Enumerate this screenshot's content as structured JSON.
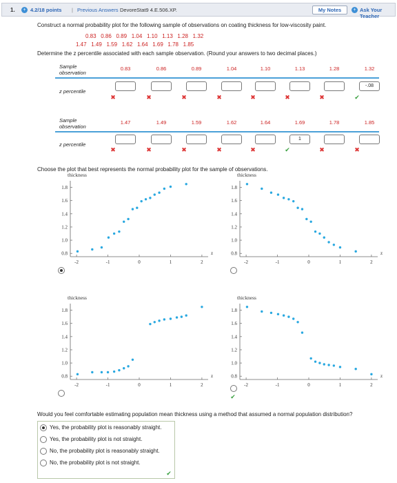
{
  "header": {
    "question_number": "1.",
    "points": "4.2/18 points",
    "separator": "|",
    "previous_answers": "Previous Answers",
    "source_ref": "DevoreStat9 4.E.506.XP.",
    "my_notes": "My Notes",
    "ask_teacher": "Ask Your Teacher"
  },
  "question": {
    "prompt": "Construct a normal probability plot for the following sample of observations on coating thickness for low-viscosity paint.",
    "data_line_1": "0.83   0.86   0.89   1.04   1.10   1.13   1.28   1.32",
    "data_line_2": "1.47   1.49   1.59   1.62   1.64   1.69   1.78   1.85",
    "instruction": "Determine the z percentile associated with each sample observation. (Round your answers to two decimal places.)"
  },
  "table": {
    "sample_label_1": "Sample",
    "sample_label_2": "observation",
    "z_label": "z percentile",
    "row1_values": [
      "0.83",
      "0.86",
      "0.89",
      "1.04",
      "1.10",
      "1.13",
      "1.28",
      "1.32"
    ],
    "row1_inputs": [
      "",
      "",
      "",
      "",
      "",
      "",
      "",
      "-.08"
    ],
    "row1_marks": [
      "x",
      "x",
      "x",
      "x",
      "x",
      "x",
      "x",
      "check"
    ],
    "row2_values": [
      "1.47",
      "1.49",
      "1.59",
      "1.62",
      "1.64",
      "1.69",
      "1.78",
      "1.85"
    ],
    "row2_inputs": [
      "",
      "",
      "",
      "",
      "",
      "1",
      "",
      ""
    ],
    "row2_marks": [
      "x",
      "x",
      "x",
      "x",
      "x",
      "check",
      "x",
      "x"
    ]
  },
  "plot_question": "Choose the plot that best represents the normal probability plot for the sample of observations.",
  "plots": {
    "y_label": "thickness",
    "x_label": "z",
    "y_ticks": [
      "1.8",
      "1.6",
      "1.4",
      "1.2",
      "1.0",
      "0.8"
    ],
    "x_ticks": [
      "-2",
      "-1",
      "0",
      "1",
      "2"
    ],
    "selected_index": 0,
    "correct_index": 3
  },
  "chart_data": [
    {
      "type": "scatter",
      "title": "",
      "xlabel": "z",
      "ylabel": "thickness",
      "xlim": [
        -2.2,
        2.2
      ],
      "ylim": [
        0.75,
        1.9
      ],
      "x": [
        -1.97,
        -1.5,
        -1.2,
        -0.98,
        -0.8,
        -0.64,
        -0.49,
        -0.35,
        -0.21,
        -0.07,
        0.07,
        0.21,
        0.35,
        0.49,
        0.64,
        0.8,
        1.0,
        1.5
      ],
      "y": [
        0.83,
        0.86,
        0.89,
        1.04,
        1.1,
        1.13,
        1.28,
        1.32,
        1.47,
        1.49,
        1.59,
        1.62,
        1.64,
        1.69,
        1.72,
        1.78,
        1.81,
        1.85
      ]
    },
    {
      "type": "scatter",
      "title": "",
      "xlabel": "z",
      "ylabel": "thickness",
      "xlim": [
        -2.2,
        2.2
      ],
      "ylim": [
        0.75,
        1.9
      ],
      "x": [
        -1.97,
        -1.5,
        -1.2,
        -0.98,
        -0.8,
        -0.64,
        -0.49,
        -0.35,
        -0.21,
        -0.07,
        0.07,
        0.21,
        0.35,
        0.49,
        0.64,
        0.8,
        1.0,
        1.5
      ],
      "y": [
        1.85,
        1.78,
        1.72,
        1.69,
        1.64,
        1.62,
        1.59,
        1.49,
        1.47,
        1.32,
        1.28,
        1.13,
        1.1,
        1.04,
        0.97,
        0.93,
        0.89,
        0.83
      ]
    },
    {
      "type": "scatter",
      "title": "",
      "xlabel": "z",
      "ylabel": "thickness",
      "xlim": [
        -2.2,
        2.2
      ],
      "ylim": [
        0.75,
        1.9
      ],
      "x": [
        -1.97,
        -1.5,
        -1.2,
        -1.0,
        -0.8,
        -0.64,
        -0.49,
        -0.35,
        -0.21,
        0.35,
        0.49,
        0.64,
        0.8,
        1.0,
        1.2,
        1.35,
        1.5,
        2.0
      ],
      "y": [
        0.83,
        0.86,
        0.86,
        0.86,
        0.87,
        0.89,
        0.92,
        0.95,
        1.05,
        1.59,
        1.62,
        1.64,
        1.66,
        1.67,
        1.69,
        1.7,
        1.72,
        1.85
      ]
    },
    {
      "type": "scatter",
      "title": "",
      "xlabel": "z",
      "ylabel": "thickness",
      "xlim": [
        -2.2,
        2.2
      ],
      "ylim": [
        0.75,
        1.9
      ],
      "x": [
        -1.97,
        -1.5,
        -1.2,
        -0.98,
        -0.8,
        -0.64,
        -0.49,
        -0.35,
        -0.21,
        0.07,
        0.21,
        0.35,
        0.49,
        0.64,
        0.8,
        1.0,
        1.5,
        2.0
      ],
      "y": [
        1.85,
        1.78,
        1.76,
        1.74,
        1.72,
        1.7,
        1.67,
        1.62,
        1.46,
        1.07,
        1.02,
        1.0,
        0.98,
        0.97,
        0.96,
        0.94,
        0.91,
        0.83
      ]
    }
  ],
  "final_question": {
    "prompt": "Would you feel comfortable estimating population mean thickness using a method that assumed a normal population distribution?",
    "options": [
      "Yes, the probability plot is reasonably straight.",
      "Yes, the probability plot is not straight.",
      "No, the probability plot is reasonably straight.",
      "No, the probability plot is not straight."
    ],
    "selected_index": 0
  }
}
